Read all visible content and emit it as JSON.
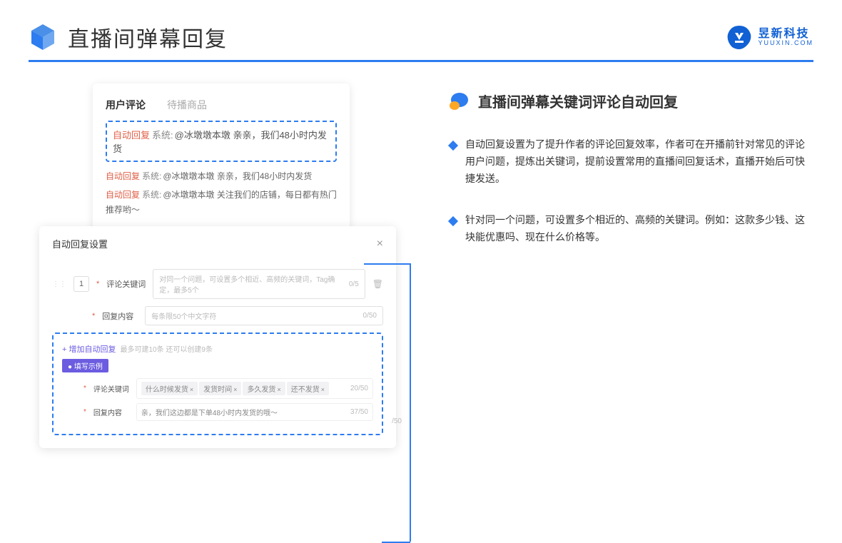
{
  "header": {
    "title": "直播间弹幕回复",
    "brand_cn": "昱新科技",
    "brand_en": "YUUXIN.COM"
  },
  "preview": {
    "tab1": "用户评论",
    "tab2": "待播商品",
    "auto": "自动回复",
    "sys": "系统:",
    "line1": "@冰墩墩本墩 亲亲，我们48小时内发货",
    "line2": "@冰墩墩本墩 亲亲，我们48小时内发货",
    "line3": "@冰墩墩本墩 关注我们的店铺，每日都有热门推荐哟～"
  },
  "settings": {
    "title": "自动回复设置",
    "close": "×",
    "seq": "1",
    "label_kw": "评论关键词",
    "ph_kw": "对同一个问题，可设置多个相近、高频的关键词，Tag确定，最多5个",
    "count_kw": "0/5",
    "label_reply": "回复内容",
    "ph_reply": "每条限50个中文字符",
    "count_reply": "0/50",
    "add": "+ 增加自动回复",
    "add_hint": "最多可建10条 还可以创建9条",
    "badge": "● 填写示例",
    "ex_label_kw": "评论关键词",
    "ex_kw_count": "20/50",
    "tags": [
      "什么时候发货",
      "发货时间",
      "多久发货",
      "还不发货"
    ],
    "ex_label_reply": "回复内容",
    "ex_reply": "亲，我们这边都是下单48小时内发货的哦～",
    "ex_reply_count": "37/50",
    "outer_count": "/50"
  },
  "right": {
    "heading": "直播间弹幕关键词评论自动回复",
    "b1": "自动回复设置为了提升作者的评论回复效率，作者可在开播前针对常见的评论用户问题，提炼出关键词，提前设置常用的直播间回复话术，直播开始后可快捷发送。",
    "b2": "针对同一个问题，可设置多个相近的、高频的关键词。例如：这款多少钱、这块能优惠吗、现在什么价格等。"
  }
}
